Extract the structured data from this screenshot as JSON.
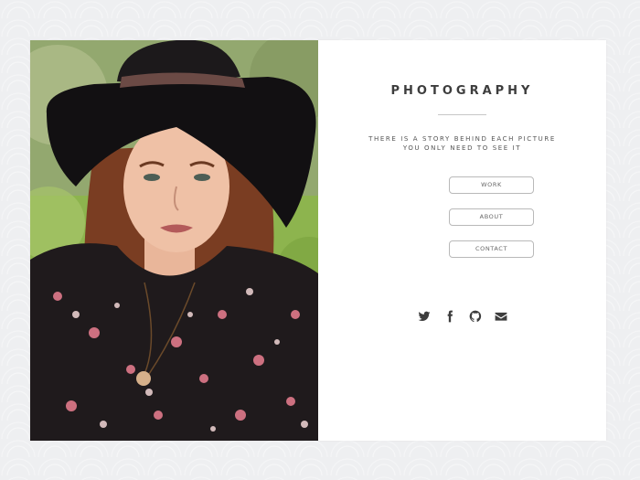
{
  "brand": {
    "title": "PHOTOGRAPHY",
    "tagline_line1": "THERE IS A STORY BEHIND EACH PICTURE",
    "tagline_line2": "YOU ONLY NEED TO SEE IT"
  },
  "nav": {
    "work_label": "WORK",
    "about_label": "ABOUT",
    "contact_label": "CONTACT"
  },
  "social": {
    "icons": [
      "twitter-icon",
      "facebook-icon",
      "github-icon",
      "envelope-icon"
    ]
  },
  "colors": {
    "page_background": "#eeeff1",
    "card_background": "#ffffff",
    "text_dark": "#3d3d3d",
    "button_border": "#b9b9b9"
  }
}
